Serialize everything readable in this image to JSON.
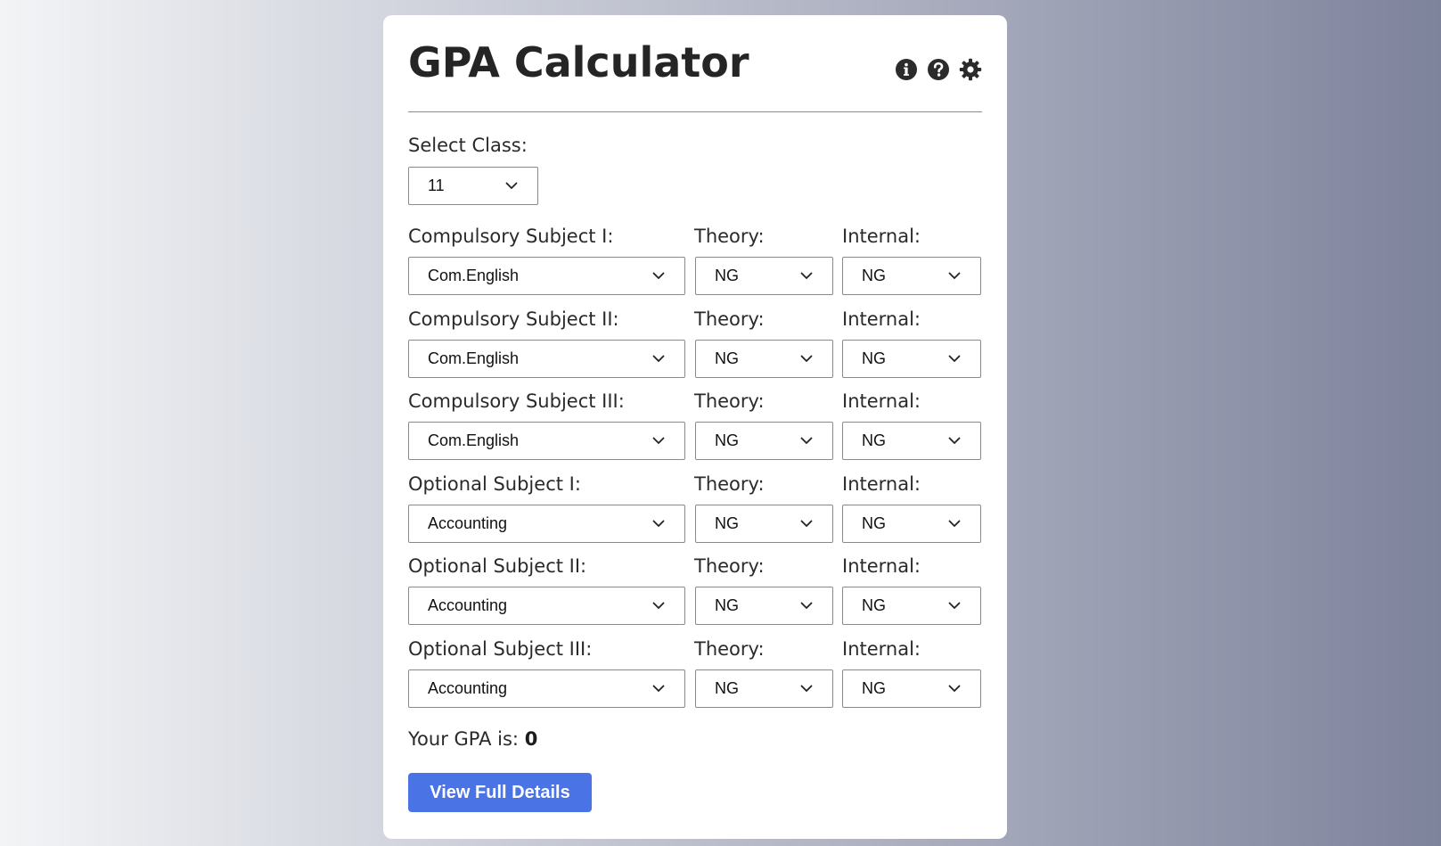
{
  "title": "GPA Calculator",
  "header_icons": [
    "info-icon",
    "help-icon",
    "gear-icon"
  ],
  "class_select": {
    "label": "Select Class:",
    "value": "11"
  },
  "column_labels": {
    "theory": "Theory:",
    "internal": "Internal:"
  },
  "subjects": [
    {
      "label": "Compulsory Subject I:",
      "subject": "Com.English",
      "theory": "NG",
      "internal": "NG"
    },
    {
      "label": "Compulsory Subject II:",
      "subject": "Com.English",
      "theory": "NG",
      "internal": "NG"
    },
    {
      "label": "Compulsory Subject III:",
      "subject": "Com.English",
      "theory": "NG",
      "internal": "NG"
    },
    {
      "label": "Optional Subject I:",
      "subject": "Accounting",
      "theory": "NG",
      "internal": "NG"
    },
    {
      "label": "Optional Subject II:",
      "subject": "Accounting",
      "theory": "NG",
      "internal": "NG"
    },
    {
      "label": "Optional Subject III:",
      "subject": "Accounting",
      "theory": "NG",
      "internal": "NG"
    }
  ],
  "gpa": {
    "label": "Your GPA is:",
    "value": "0"
  },
  "details_button": "View Full Details",
  "colors": {
    "button": "#4a73e5",
    "card": "#ffffff",
    "title": "#252525"
  }
}
